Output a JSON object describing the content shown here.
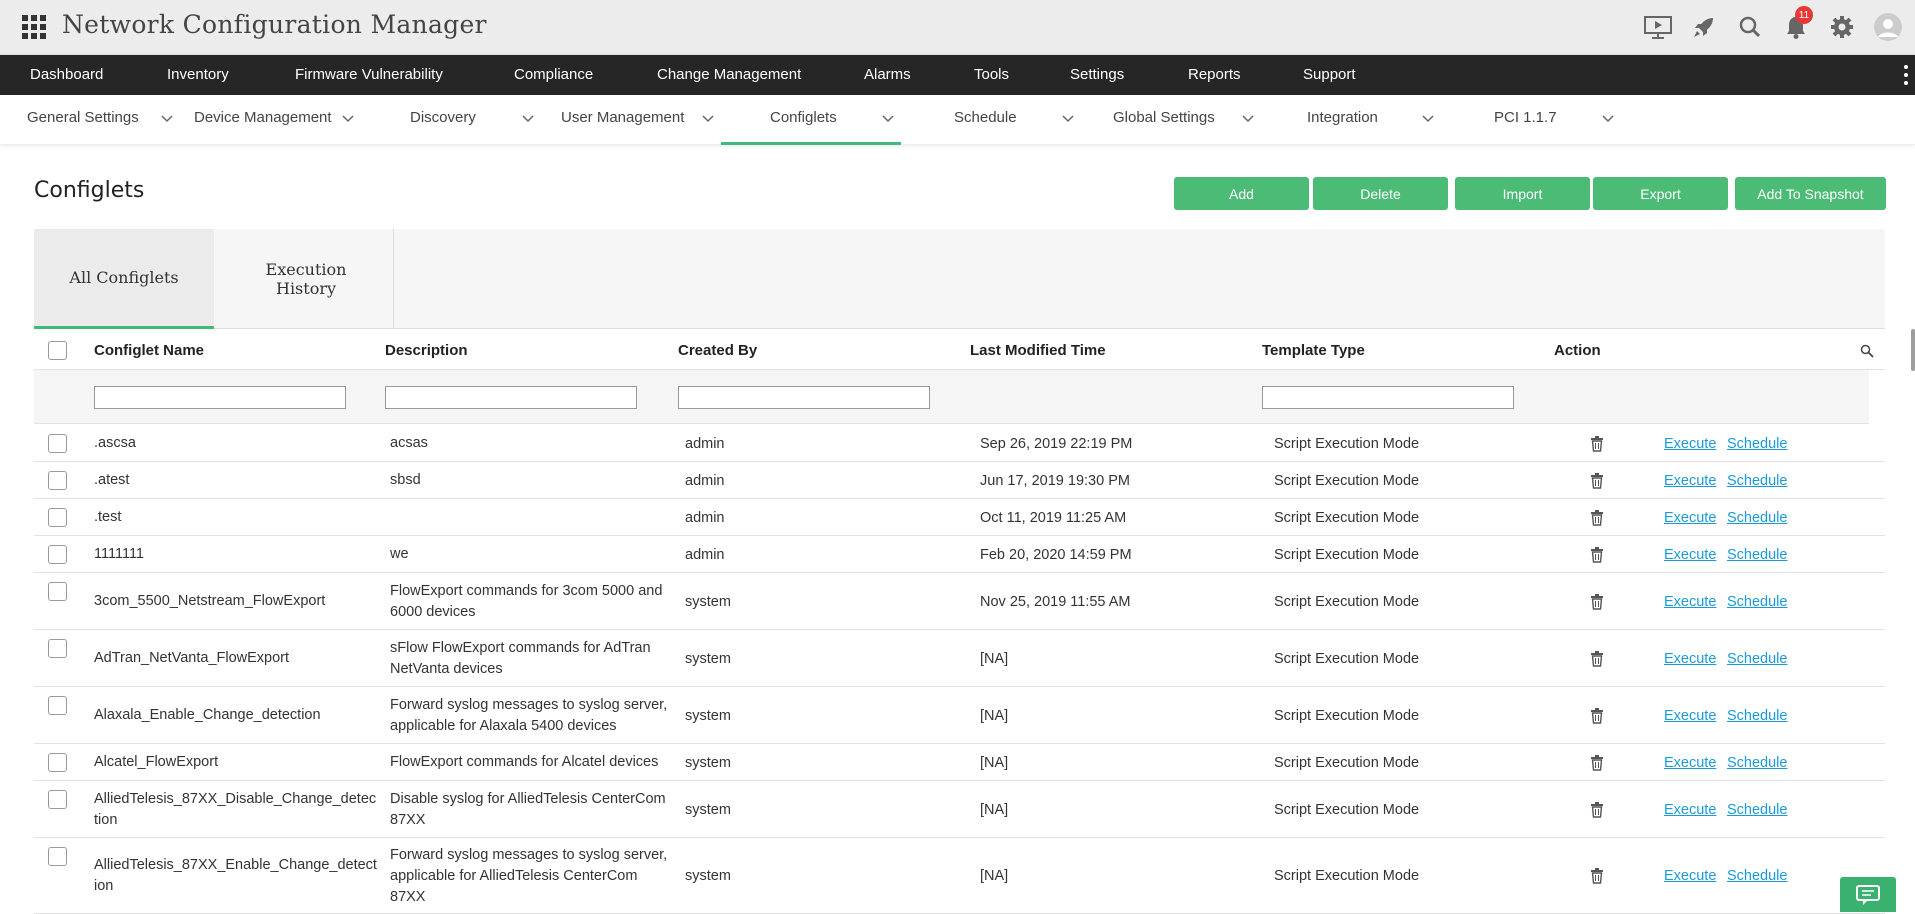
{
  "app": {
    "title": "Network Configuration Manager",
    "notifications_count": "11"
  },
  "main_nav": [
    {
      "label": "Dashboard"
    },
    {
      "label": "Inventory"
    },
    {
      "label": "Firmware Vulnerability"
    },
    {
      "label": "Compliance"
    },
    {
      "label": "Change Management"
    },
    {
      "label": "Alarms"
    },
    {
      "label": "Tools"
    },
    {
      "label": "Settings"
    },
    {
      "label": "Reports"
    },
    {
      "label": "Support"
    }
  ],
  "sub_nav": [
    {
      "label": "General Settings"
    },
    {
      "label": "Device Management"
    },
    {
      "label": "Discovery"
    },
    {
      "label": "User Management"
    },
    {
      "label": "Configlets",
      "active": true
    },
    {
      "label": "Schedule"
    },
    {
      "label": "Global Settings"
    },
    {
      "label": "Integration"
    },
    {
      "label": "PCI 1.1.7"
    }
  ],
  "page": {
    "title": "Configlets",
    "buttons": {
      "add": "Add",
      "delete": "Delete",
      "import": "Import",
      "export": "Export",
      "snapshot": "Add To Snapshot"
    },
    "tabs": {
      "all": "All Configlets",
      "history_line1": "Execution",
      "history_line2": "History"
    }
  },
  "table": {
    "headers": {
      "name": "Configlet Name",
      "description": "Description",
      "created_by": "Created By",
      "last_modified": "Last Modified Time",
      "template_type": "Template Type",
      "action": "Action"
    },
    "action_links": {
      "execute": "Execute",
      "schedule": "Schedule"
    },
    "rows": [
      {
        "name": [
          ".ascsa"
        ],
        "description": [
          "acsas"
        ],
        "created_by": "admin",
        "last_modified": "Sep 26, 2019 22:19 PM",
        "template_type": "Script Execution Mode"
      },
      {
        "name": [
          ".atest"
        ],
        "description": [
          "sbsd"
        ],
        "created_by": "admin",
        "last_modified": "Jun 17, 2019 19:30 PM",
        "template_type": "Script Execution Mode"
      },
      {
        "name": [
          ".test"
        ],
        "description": [
          ""
        ],
        "created_by": "admin",
        "last_modified": "Oct 11, 2019 11:25 AM",
        "template_type": "Script Execution Mode"
      },
      {
        "name": [
          "1111111"
        ],
        "description": [
          "we"
        ],
        "created_by": "admin",
        "last_modified": "Feb 20, 2020 14:59 PM",
        "template_type": "Script Execution Mode"
      },
      {
        "name": [
          "3com_5500_Netstream_FlowExport"
        ],
        "description": [
          "FlowExport commands for 3com 5000 and",
          "6000 devices"
        ],
        "created_by": "system",
        "last_modified": "Nov 25, 2019 11:55 AM",
        "template_type": "Script Execution Mode"
      },
      {
        "name": [
          "AdTran_NetVanta_FlowExport"
        ],
        "description": [
          "sFlow FlowExport commands for AdTran",
          "NetVanta devices"
        ],
        "created_by": "system",
        "last_modified": "[NA]",
        "template_type": "Script Execution Mode"
      },
      {
        "name": [
          "Alaxala_Enable_Change_detection"
        ],
        "description": [
          "Forward syslog messages to syslog server,",
          "applicable for Alaxala 5400 devices"
        ],
        "created_by": "system",
        "last_modified": "[NA]",
        "template_type": "Script Execution Mode"
      },
      {
        "name": [
          "Alcatel_FlowExport"
        ],
        "description": [
          "FlowExport commands for Alcatel devices"
        ],
        "created_by": "system",
        "last_modified": "[NA]",
        "template_type": "Script Execution Mode"
      },
      {
        "name": [
          "AlliedTelesis_87XX_Disable_Change_detec",
          "tion"
        ],
        "description": [
          "Disable syslog for AlliedTelesis CenterCom",
          "87XX"
        ],
        "created_by": "system",
        "last_modified": "[NA]",
        "template_type": "Script Execution Mode"
      },
      {
        "name": [
          "AlliedTelesis_87XX_Enable_Change_detect",
          "ion"
        ],
        "description": [
          "Forward syslog messages to syslog server,",
          "applicable for AlliedTelesis CenterCom",
          "87XX"
        ],
        "created_by": "system",
        "last_modified": "[NA]",
        "template_type": "Script Execution Mode"
      }
    ]
  },
  "colors": {
    "accent": "#4cbb76",
    "nav_bg": "#262626",
    "link": "#1a9bd7",
    "badge": "#e53935"
  }
}
